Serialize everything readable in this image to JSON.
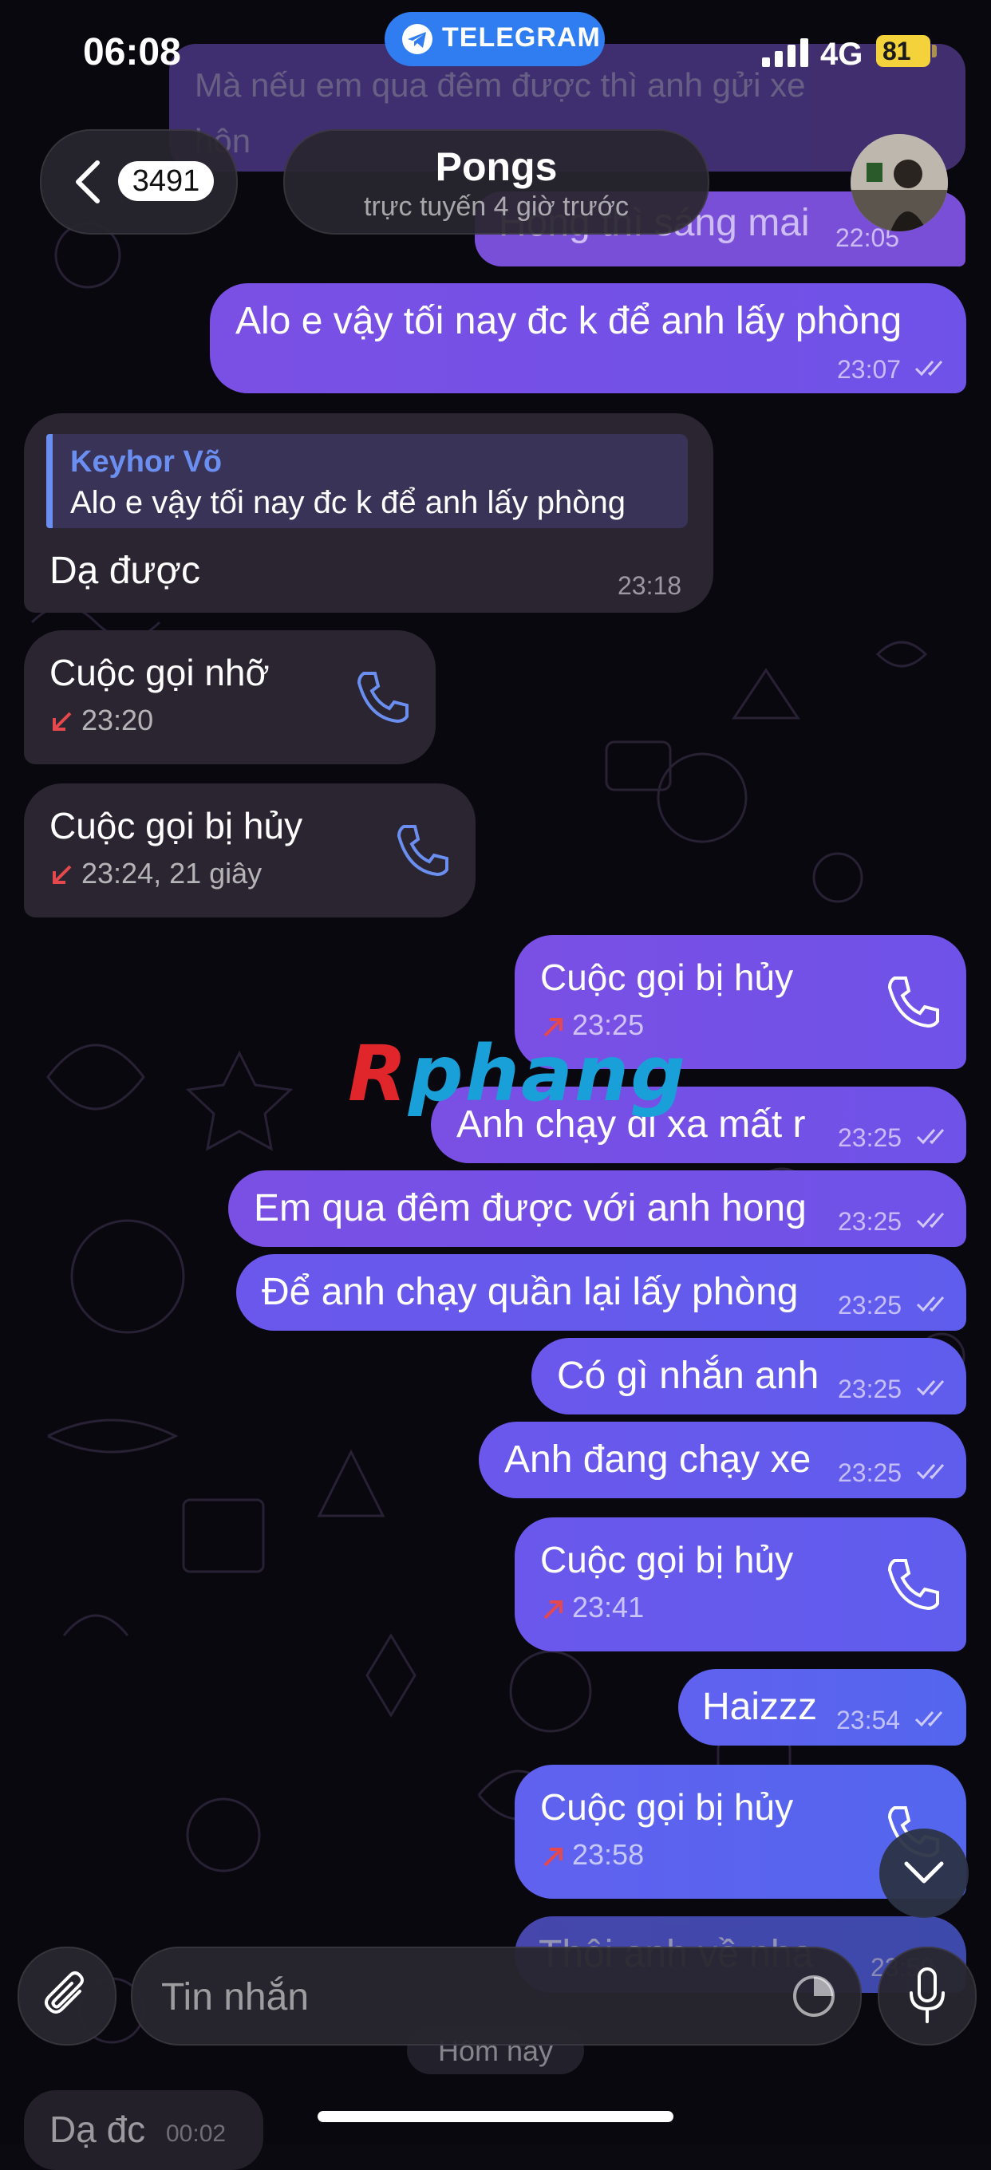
{
  "status_bar": {
    "time": "06:08",
    "app_pill": "TELEGRAM",
    "network": "4G",
    "battery": "81"
  },
  "header": {
    "back_count": "3491",
    "contact_name": "Pongs",
    "contact_status": "trực tuyến 4 giờ trước"
  },
  "partial_top": {
    "line1": "Mà nếu em qua đêm được thì anh gửi xe",
    "line2": "hôn",
    "bubble2_text": "Hông thì sáng mai",
    "bubble2_time": "22:05"
  },
  "messages": [
    {
      "type": "text",
      "direction": "outgoing",
      "text": "Alo e vậy tối nay đc k để anh lấy phòng",
      "time": "23:07"
    },
    {
      "type": "reply",
      "direction": "incoming",
      "reply_author": "Keyhor Võ",
      "reply_text": "Alo e vậy tối nay đc k để anh lấy phòng",
      "text": "Dạ được",
      "time": "23:18"
    },
    {
      "type": "call",
      "direction": "incoming",
      "title": "Cuộc gọi nhỡ",
      "detail": "23:20"
    },
    {
      "type": "call",
      "direction": "incoming",
      "title": "Cuộc gọi bị hủy",
      "detail": "23:24, 21 giây"
    },
    {
      "type": "call",
      "direction": "outgoing",
      "title": "Cuộc gọi bị hủy",
      "detail": "23:25"
    },
    {
      "type": "text",
      "direction": "outgoing",
      "text": "Anh chạy đi xa mất r",
      "time": "23:25"
    },
    {
      "type": "text",
      "direction": "outgoing",
      "text": "Em qua đêm được với anh hong",
      "time": "23:25"
    },
    {
      "type": "text",
      "direction": "outgoing",
      "text": "Để anh chạy quần lại lấy phòng",
      "time": "23:25"
    },
    {
      "type": "text",
      "direction": "outgoing",
      "text": "Có gì nhắn anh",
      "time": "23:25"
    },
    {
      "type": "text",
      "direction": "outgoing",
      "text": "Anh đang chạy xe",
      "time": "23:25"
    },
    {
      "type": "call",
      "direction": "outgoing",
      "title": "Cuộc gọi bị hủy",
      "detail": "23:41"
    },
    {
      "type": "text",
      "direction": "outgoing",
      "text": "Haizzz",
      "time": "23:54"
    },
    {
      "type": "call",
      "direction": "outgoing",
      "title": "Cuộc gọi bị hủy",
      "detail": "23:58"
    },
    {
      "type": "text",
      "direction": "outgoing",
      "text": "Thôi anh về nha",
      "time": "23:59"
    }
  ],
  "below_composer": {
    "date_chip": "Hôm nay",
    "bubble_text": "Dạ đc",
    "bubble_time": "00:02"
  },
  "watermark": {
    "first": "R",
    "rest": "phang"
  },
  "composer": {
    "placeholder": "Tin nhắn"
  },
  "colors": {
    "outgoing": "#7a4fe4",
    "incoming": "#2a2530",
    "accent": "#6b8ff0",
    "missed": "#e5484d"
  },
  "icons": {
    "attach": "paperclip-icon",
    "mic": "microphone-icon",
    "sticker": "sticker-icon",
    "scroll": "chevron-down-icon",
    "back": "chevron-left-icon",
    "phone": "phone-icon",
    "telegram": "paper-plane-icon"
  }
}
